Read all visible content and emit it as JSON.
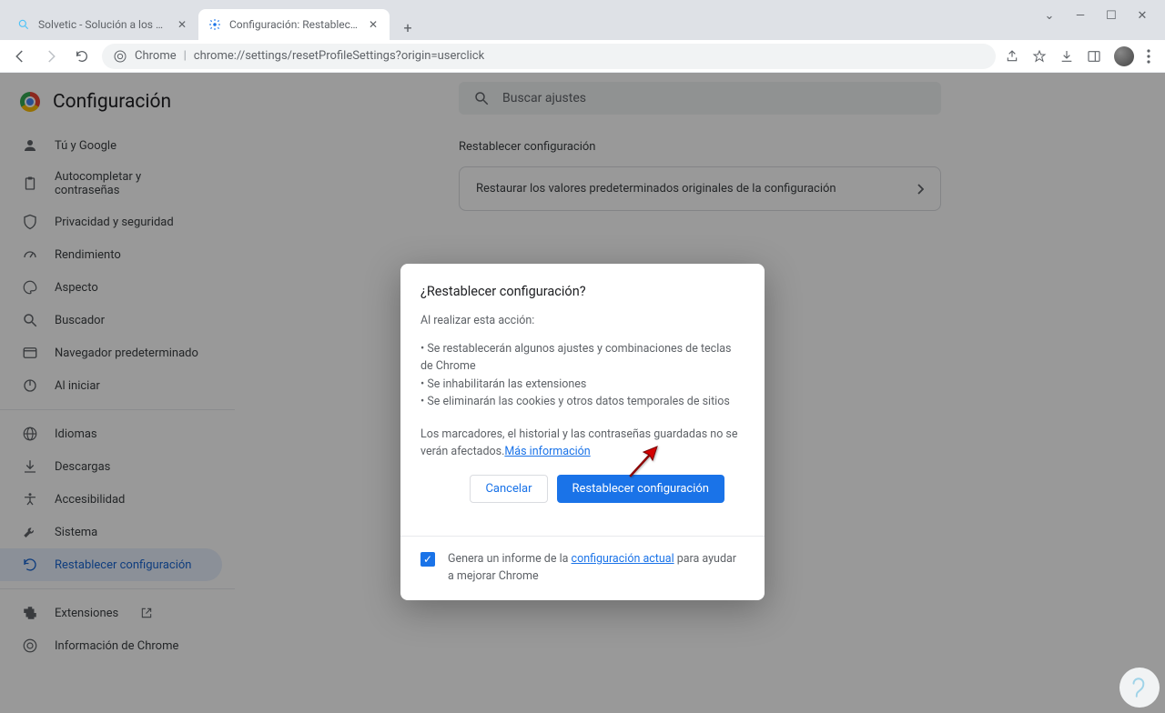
{
  "window_controls": {
    "chevron": "⌄",
    "min": "—",
    "max": "☐",
    "close": "✕"
  },
  "tabs": [
    {
      "title": "Solvetic - Solución a los problem",
      "active": false
    },
    {
      "title": "Configuración: Restablecer confi",
      "active": true
    }
  ],
  "omnibox": {
    "prefix": "Chrome",
    "url": "chrome://settings/resetProfileSettings?origin=userclick"
  },
  "settings_title": "Configuración",
  "sidebar": {
    "items": [
      {
        "label": "Tú y Google",
        "icon": "person"
      },
      {
        "label": "Autocompletar y contraseñas",
        "icon": "clipboard"
      },
      {
        "label": "Privacidad y seguridad",
        "icon": "shield"
      },
      {
        "label": "Rendimiento",
        "icon": "speed"
      },
      {
        "label": "Aspecto",
        "icon": "palette"
      },
      {
        "label": "Buscador",
        "icon": "search"
      },
      {
        "label": "Navegador predeterminado",
        "icon": "browser"
      },
      {
        "label": "Al iniciar",
        "icon": "power"
      }
    ],
    "items2": [
      {
        "label": "Idiomas",
        "icon": "globe"
      },
      {
        "label": "Descargas",
        "icon": "download"
      },
      {
        "label": "Accesibilidad",
        "icon": "accessibility"
      },
      {
        "label": "Sistema",
        "icon": "wrench"
      },
      {
        "label": "Restablecer configuración",
        "icon": "reset",
        "active": true
      }
    ],
    "items3": [
      {
        "label": "Extensiones",
        "icon": "extension",
        "external": true
      },
      {
        "label": "Información de Chrome",
        "icon": "chrome"
      }
    ]
  },
  "search_placeholder": "Buscar ajustes",
  "section_title": "Restablecer configuración",
  "reset_row": "Restaurar los valores predeterminados originales de la configuración",
  "dialog": {
    "title": "¿Restablecer configuración?",
    "sub": "Al realizar esta acción:",
    "bullets": [
      "Se restablecerán algunos ajustes y combinaciones de teclas de Chrome",
      "Se inhabilitarán las extensiones",
      "Se eliminarán las cookies y otros datos temporales de sitios"
    ],
    "note_pre": "Los marcadores, el historial y las contraseñas guardadas no se verán afectados.",
    "note_link": "Más información",
    "cancel": "Cancelar",
    "confirm": "Restablecer configuración",
    "report_pre": "Genera un informe de la ",
    "report_link": "configuración actual",
    "report_post": " para ayudar a mejorar Chrome"
  }
}
